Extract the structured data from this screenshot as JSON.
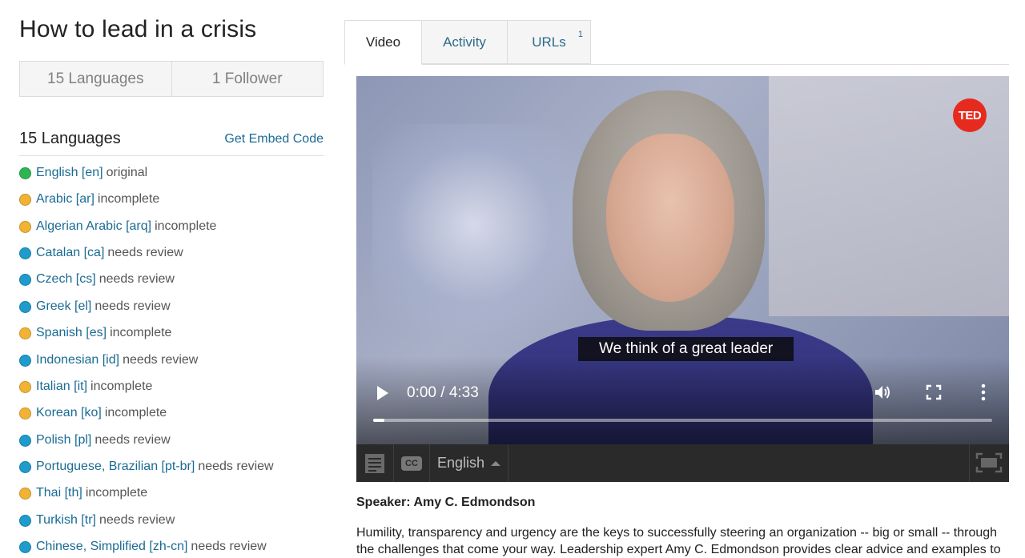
{
  "page": {
    "title": "How to lead in a crisis"
  },
  "stats": [
    {
      "label": "15 Languages"
    },
    {
      "label": "1 Follower"
    }
  ],
  "languages_section": {
    "heading": "15 Languages",
    "embed_link": "Get Embed Code"
  },
  "status_colors": {
    "original": "#2db553",
    "incomplete": "#f2b335",
    "needs-review": "#1f9ccc"
  },
  "languages": [
    {
      "name": "English [en]",
      "status": "original",
      "state": "original"
    },
    {
      "name": "Arabic [ar]",
      "status": "incomplete",
      "state": "incomplete"
    },
    {
      "name": "Algerian Arabic [arq]",
      "status": "incomplete",
      "state": "incomplete"
    },
    {
      "name": "Catalan [ca]",
      "status": "needs review",
      "state": "needs-review"
    },
    {
      "name": "Czech [cs]",
      "status": "needs review",
      "state": "needs-review"
    },
    {
      "name": "Greek [el]",
      "status": "needs review",
      "state": "needs-review"
    },
    {
      "name": "Spanish [es]",
      "status": "incomplete",
      "state": "incomplete"
    },
    {
      "name": "Indonesian [id]",
      "status": "needs review",
      "state": "needs-review"
    },
    {
      "name": "Italian [it]",
      "status": "incomplete",
      "state": "incomplete"
    },
    {
      "name": "Korean [ko]",
      "status": "incomplete",
      "state": "incomplete"
    },
    {
      "name": "Polish [pl]",
      "status": "needs review",
      "state": "needs-review"
    },
    {
      "name": "Portuguese, Brazilian [pt-br]",
      "status": "needs review",
      "state": "needs-review"
    },
    {
      "name": "Thai [th]",
      "status": "incomplete",
      "state": "incomplete"
    },
    {
      "name": "Turkish [tr]",
      "status": "needs review",
      "state": "needs-review"
    },
    {
      "name": "Chinese, Simplified [zh-cn]",
      "status": "needs review",
      "state": "needs-review"
    }
  ],
  "tabs": [
    {
      "label": "Video",
      "active": true
    },
    {
      "label": "Activity",
      "active": false
    },
    {
      "label": "URLs",
      "active": false,
      "badge": "1"
    }
  ],
  "video": {
    "brand": "TED",
    "caption": "We think of a great leader",
    "time": "0:00 / 4:33",
    "progress_fraction": 0.0
  },
  "player_bar": {
    "cc_label": "CC",
    "language": "English"
  },
  "details": {
    "speaker": "Speaker: Amy C. Edmondson",
    "description": "Humility, transparency and urgency are the keys to successfully steering an organization -- big or small -- through the challenges that come your way. Leadership expert Amy C. Edmondson provides clear advice and examples to"
  }
}
